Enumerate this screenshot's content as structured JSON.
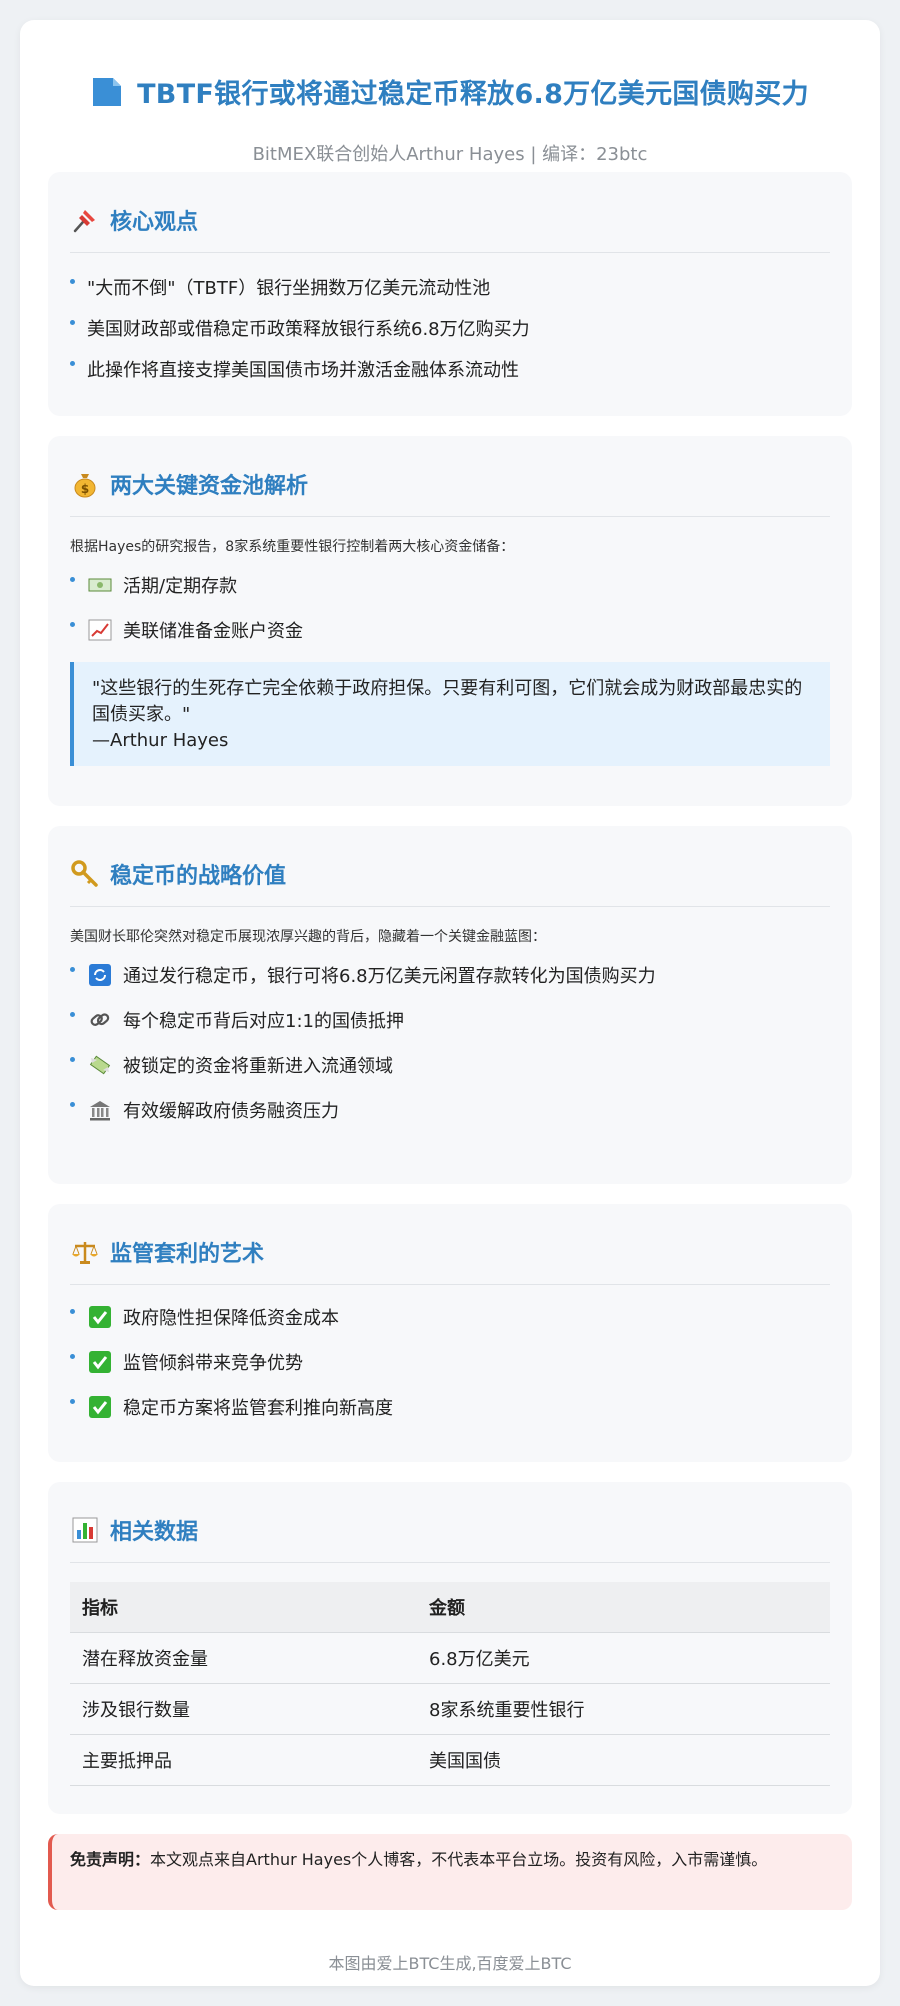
{
  "header": {
    "title": "TBTF银行或将通过稳定币释放6.8万亿美元国债购买力",
    "subtitle": "BitMEX联合创始人Arthur Hayes | 编译：23btc"
  },
  "core": {
    "title": "核心观点",
    "items": [
      "\"大而不倒\"（TBTF）银行坐拥数万亿美元流动性池",
      "美国财政部或借稳定币政策释放银行系统6.8万亿购买力",
      "此操作将直接支撑美国国债市场并激活金融体系流动性"
    ]
  },
  "pools": {
    "title": "两大关键资金池解析",
    "intro": "根据Hayes的研究报告，8家系统重要性银行控制着两大核心资金储备：",
    "items": [
      "活期/定期存款",
      "美联储准备金账户资金"
    ],
    "quote": "\"这些银行的生死存亡完全依赖于政府担保。只要有利可图，它们就会成为财政部最忠实的国债买家。\"",
    "quote_author": "—Arthur Hayes"
  },
  "strategy": {
    "title": "稳定币的战略价值",
    "intro": "美国财长耶伦突然对稳定币展现浓厚兴趣的背后，隐藏着一个关键金融蓝图：",
    "items": [
      "通过发行稳定币，银行可将6.8万亿美元闲置存款转化为国债购买力",
      "每个稳定币背后对应1:1的国债抵押",
      "被锁定的资金将重新进入流通领域",
      "有效缓解政府债务融资压力"
    ]
  },
  "arbitrage": {
    "title": "监管套利的艺术",
    "items": [
      "政府隐性担保降低资金成本",
      "监管倾斜带来竞争优势",
      "稳定币方案将监管套利推向新高度"
    ]
  },
  "data": {
    "title": "相关数据",
    "headers": [
      "指标",
      "金额"
    ],
    "rows": [
      [
        "潜在释放资金量",
        "6.8万亿美元"
      ],
      [
        "涉及银行数量",
        "8家系统重要性银行"
      ],
      [
        "主要抵押品",
        "美国国债"
      ]
    ]
  },
  "disclaimer": {
    "label": "免责声明：",
    "text": "本文观点来自Arthur Hayes个人博客，不代表本平台立场。投资有风险，入市需谨慎。"
  },
  "footer": "本图由爱上BTC生成,百度爱上BTC",
  "colors": {
    "accent": "#2f7fc0",
    "bullet": "#3a8fd6",
    "warning": "#e25a4f"
  }
}
